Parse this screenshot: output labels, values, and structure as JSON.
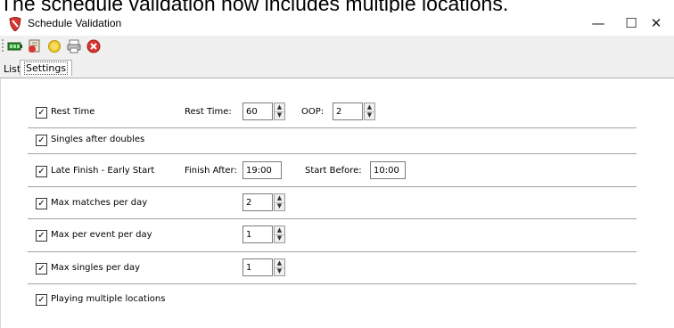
{
  "caption": "The schedule validation now includes multiple locations.",
  "window": {
    "title": "Schedule Validation",
    "controls": {
      "minimize": "—",
      "maximize": "☐",
      "close": "✕"
    }
  },
  "toolbar": {
    "icons": [
      "battery-icon",
      "script-icon",
      "coin-icon",
      "printer-icon",
      "cancel-icon"
    ],
    "colors": {
      "green": "#2e8b2e",
      "red": "#d9362f",
      "gold": "#f2c928",
      "blue": "#4a7fc1"
    }
  },
  "tabs": {
    "list": "List",
    "settings": "Settings"
  },
  "settings": {
    "rest_time": {
      "checked": true,
      "label": "Rest Time",
      "rest_time_label": "Rest Time:",
      "rest_time_value": "60",
      "oop_label": "OOP:",
      "oop_value": "2"
    },
    "singles_after_doubles": {
      "checked": true,
      "label": "Singles after doubles"
    },
    "late_finish": {
      "checked": true,
      "label": "Late Finish - Early Start",
      "finish_after_label": "Finish After:",
      "finish_after_value": "19:00",
      "start_before_label": "Start Before:",
      "start_before_value": "10:00"
    },
    "max_matches_per_day": {
      "checked": true,
      "label": "Max matches per day",
      "value": "2"
    },
    "max_per_event_per_day": {
      "checked": true,
      "label": "Max per event per day",
      "value": "1"
    },
    "max_singles_per_day": {
      "checked": true,
      "label": "Max singles per day",
      "value": "1"
    },
    "playing_multiple_locations": {
      "checked": true,
      "label": "Playing multiple locations"
    }
  },
  "glyphs": {
    "check": "✓",
    "spin_up": "▲",
    "spin_down": "▼"
  }
}
